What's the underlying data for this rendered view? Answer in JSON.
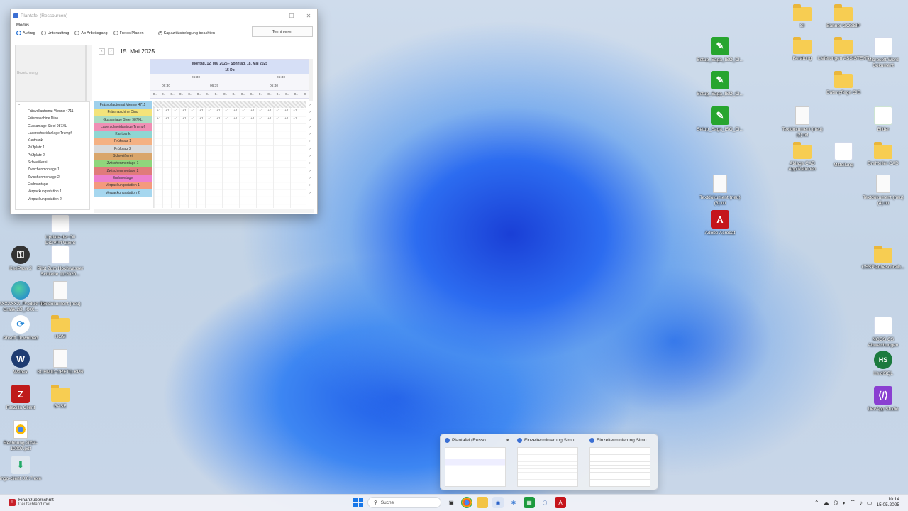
{
  "window": {
    "title": "Plantafel (Ressourcen)",
    "mode_label": "Modus",
    "modes": [
      "Auftrag",
      "Unterauftrag",
      "Ab Arbeitsgang",
      "Freies Planen"
    ],
    "selected_mode": "Auftrag",
    "capacity_checkbox": "Kapazitätsbelegung beachten",
    "terminate_button": "Terminieren",
    "left_header": "Bezeichnung",
    "date_title": "15. Mai 2025",
    "week_range": "Montag, 12. Mai 2025 - Sonntag, 18. Mai 2025",
    "day_label": "15 Do",
    "hour_label_1": "06:30",
    "hour_label_2": "06:40",
    "minute_labels": [
      "06:30",
      "06:35",
      "06:40"
    ],
    "zero_cells": [
      "0..",
      "0..",
      "0..",
      "0..",
      "0..",
      "0..",
      "0..",
      "0..",
      "0..",
      "0..",
      "0..",
      "0..",
      "0..",
      "0..",
      "0..",
      "0..",
      "0..",
      "0"
    ],
    "resources": [
      "Fräsvollautomat Vienne 4711",
      "Fräsmaschine Dino",
      "Gussanlage Steel 987XL",
      "Laserschneidanlage Trumpf",
      "Kantbank",
      "Prüfplatz 1",
      "Prüfplatz 2",
      "Schweißerei",
      "Zwischenmontage 1",
      "Zwischenmontage 2",
      "Endmontage",
      "Verpackungsstation 1",
      "Verpackungsstation 2"
    ],
    "resource_colors": [
      "#9ed0ec",
      "#f3e37a",
      "#a9dcc2",
      "#ef8fb4",
      "#8fd6d2",
      "#f4b183",
      "#d9d9d9",
      "#d9a66b",
      "#8fd67c",
      "#e07b7b",
      "#ec7fce",
      "#f49a7d",
      "#a6d7ef"
    ],
    "plus_cells": [
      "+1",
      "+1",
      "+1",
      "+1",
      "+1",
      "+1",
      "+1",
      "+1",
      "+1",
      "+1",
      "+1",
      "+1",
      "+1",
      "+1",
      "+1",
      "+1",
      "+1"
    ]
  },
  "desktop_icons_left": [
    {
      "label": "Update der Oil DiGVP/Patient",
      "icon": "word-doc-icon"
    },
    {
      "label": "KeePass 2",
      "icon": "lock-icon"
    },
    {
      "label": "Pilot Zum Hochwasser Schliehe 11/2020...",
      "icon": "word-doc-icon"
    },
    {
      "label": "XXXXXXXX_Produkt mit Grafik 2D_XXX...",
      "icon": "edge-icon"
    },
    {
      "label": "Textdokument (neu)",
      "icon": "document-icon"
    },
    {
      "label": "Ahsoft Download",
      "icon": "sync-icon"
    },
    {
      "label": "HGM",
      "icon": "folder-icon"
    },
    {
      "label": "Webex",
      "icon": "webex-icon"
    },
    {
      "label": "SCHMID-CRETO.KPR",
      "icon": "document-icon"
    },
    {
      "label": "FileZilla Client",
      "icon": "filezilla-icon"
    },
    {
      "label": "BASE",
      "icon": "folder-icon"
    },
    {
      "label": "Rechnung 2024-10007.pdf",
      "icon": "pdf-chrome-icon"
    },
    {
      "label": "ingo-client 0.0.7.exe",
      "icon": "installer-icon"
    }
  ],
  "desktop_icons_right": [
    {
      "label": "SI",
      "icon": "folder-icon"
    },
    {
      "label": "Banner GOSSIP",
      "icon": "folder-icon"
    },
    {
      "label": "Setup_Saga_ISO_Cl...",
      "icon": "setup-tool-icon"
    },
    {
      "label": "Setup_Saga_ISO_Cl...",
      "icon": "setup-tool-icon"
    },
    {
      "label": "Setup_Saga_ISO_Cl...",
      "icon": "setup-tool-icon"
    },
    {
      "label": "Beratung",
      "icon": "folder-icon"
    },
    {
      "label": "Lieferungen ASSISTENT",
      "icon": "folder-icon"
    },
    {
      "label": "Microsoft Word Dokument",
      "icon": "word-doc-icon"
    },
    {
      "label": "Datenpflege OIS",
      "icon": "folder-icon"
    },
    {
      "label": "Textdokument (neu) (2).txt",
      "icon": "document-icon"
    },
    {
      "label": "Bilder",
      "icon": "excel-icon"
    },
    {
      "label": "Ablage CAD Applikationen",
      "icon": "folder-icon"
    },
    {
      "label": "Mitteilung",
      "icon": "word-doc-icon"
    },
    {
      "label": "Drehteiler CAD",
      "icon": "folder-icon"
    },
    {
      "label": "Textdokument (neu) (3).txt",
      "icon": "document-icon"
    },
    {
      "label": "Textdokument (neu) (4).txt",
      "icon": "document-icon"
    },
    {
      "label": "Adobe Acrobat",
      "icon": "acrobat-icon"
    },
    {
      "label": "CSSPlanbeschreib...",
      "icon": "folder-icon"
    },
    {
      "label": "NGOS CS Abweichungen",
      "icon": "word-doc-icon"
    },
    {
      "label": "HeidiSQL",
      "icon": "heidisql-icon"
    },
    {
      "label": "DevApp Studio",
      "icon": "devapp-icon"
    }
  ],
  "preview": {
    "items": [
      "Plantafel (Resso...",
      "Einzelterminierung Simulati...",
      "Einzelterminierung Simulati..."
    ]
  },
  "taskbar": {
    "notification_title": "Finanzüberschrift",
    "notification_sub": "Deutschland mel...",
    "search_placeholder": "Suche",
    "time": "10:14",
    "date": "15.05.2025",
    "colors": {
      "accent": "#1877e8"
    }
  }
}
